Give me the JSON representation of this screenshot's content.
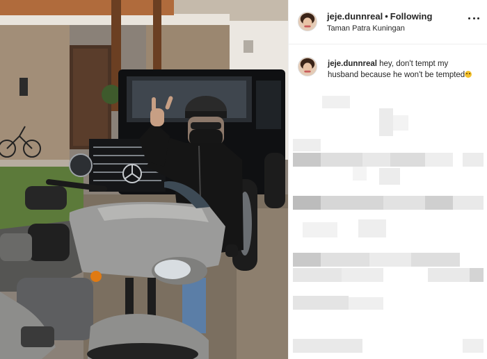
{
  "post": {
    "username": "jeje.dunnreal",
    "separator": "•",
    "follow_status": "Following",
    "location": "Taman Patra Kuningan"
  },
  "caption": {
    "username": "jeje.dunnreal",
    "text": " hey, don't tempt my husband because he won't be tempted",
    "emoji": "dizzy-face-emoji"
  },
  "icons": {
    "more": "more-options-icon",
    "avatar": "profile-avatar"
  },
  "colors": {
    "text": "#262626",
    "border": "#efefef",
    "blur_light": "#ececec",
    "blur_dark": "#c9c9c9"
  }
}
